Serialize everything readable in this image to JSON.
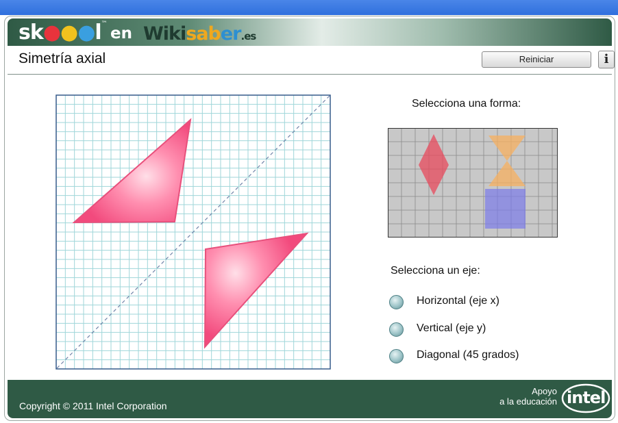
{
  "header": {
    "logo_skool": "sk",
    "logo_skool_tail": "l",
    "logo_tm": "™",
    "logo_en": "en",
    "logo_wiki": "Wiki",
    "logo_saber": "sab",
    "logo_er": "er",
    "logo_es": ".es"
  },
  "title": "Simetría axial",
  "buttons": {
    "reset": "Reiniciar",
    "info": "i"
  },
  "shapes": {
    "label": "Selecciona una forma:",
    "items": [
      "rombo",
      "reloj de arena",
      "cuadrado"
    ]
  },
  "axis": {
    "label": "Selecciona un eje:",
    "options": [
      "Horizontal (eje x)",
      "Vertical (eje y)",
      "Diagonal (45 grados)"
    ],
    "selected": "Diagonal (45 grados)"
  },
  "colors": {
    "grid_line": "#9fd6d9",
    "grid_border": "#355a8a",
    "triangle_fill": "#ff7aa3",
    "triangle_edge": "#e8507c",
    "rhombus": "#e84a5c",
    "hourglass": "#f7b060",
    "square": "#7a7ae8",
    "footer": "#2f5a45"
  },
  "footer": {
    "copyright": "Copyright © 2011 Intel Corporation",
    "support_line1": "Apoyo",
    "support_line2": "a la educación",
    "intel": "intel"
  }
}
